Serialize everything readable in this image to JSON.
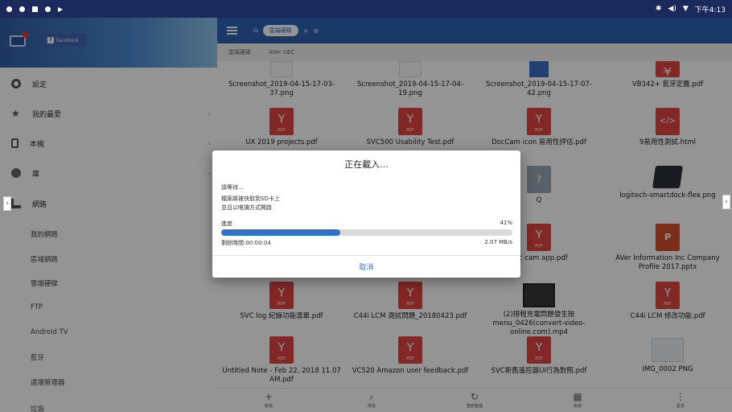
{
  "status_bar": {
    "time": "下午4:13"
  },
  "drawer": {
    "account_label": "Facebook",
    "items": [
      {
        "label": "設定"
      },
      {
        "label": "我的最愛"
      },
      {
        "label": "本機"
      },
      {
        "label": "庫"
      },
      {
        "label": "網路"
      }
    ],
    "network_subitems": [
      "我的網路",
      "區域網路",
      "雲端硬碟",
      "FTP",
      "Android TV",
      "藍牙",
      "遠端管理器",
      "垃圾"
    ]
  },
  "topbar": {
    "tab_label": "雲端硬碟"
  },
  "pathbar": {
    "segments": [
      "雲端硬碟",
      "AVer UEC"
    ]
  },
  "files": [
    {
      "name": "Screenshot_2019-04-15-17-03-37.png",
      "kind": "image"
    },
    {
      "name": "Screenshot_2019-04-15-17-04-19.png",
      "kind": "image"
    },
    {
      "name": "Screenshot_2019-04-15-17-07-42.png",
      "kind": "image"
    },
    {
      "name": "VB342+ 藍牙定義.pdf",
      "kind": "pdf"
    },
    {
      "name": "UX 2019 projects.pdf",
      "kind": "pdf"
    },
    {
      "name": "SVC500 Usability Test.pdf",
      "kind": "pdf"
    },
    {
      "name": "DocCam icon 易用性評估.pdf",
      "kind": "pdf"
    },
    {
      "name": "9易用性測試.html",
      "kind": "html"
    },
    {
      "name": "Q",
      "kind": "unknown"
    },
    {
      "name": "logitech-smartdock-flex.png",
      "kind": "image"
    },
    {
      "name": "doc cam app.pdf",
      "kind": "pdf"
    },
    {
      "name": "AVer Information Inc Company Profile 2017.pptx",
      "kind": "pptx"
    },
    {
      "name": "SVC log 紀錄功能清單.pdf",
      "kind": "pdf"
    },
    {
      "name": "C44i LCM 測試問題_20180423.pdf",
      "kind": "pdf"
    },
    {
      "name": "(2)排程充電問題發生按menu_0426(convert-video-online.com).mp4",
      "kind": "video"
    },
    {
      "name": "C44i LCM 修改功能.pdf",
      "kind": "pdf"
    },
    {
      "name": "Untitled Note - Feb 22, 2018 11.07 AM.pdf",
      "kind": "pdf"
    },
    {
      "name": "VC520 Amazon user feedback.pdf",
      "kind": "pdf"
    },
    {
      "name": "SVC新舊遙控器UI行為對照.pdf",
      "kind": "pdf"
    },
    {
      "name": "IMG_0002.PNG",
      "kind": "image"
    }
  ],
  "bottom_bar": [
    {
      "label": "新增",
      "icon": "plus-icon"
    },
    {
      "label": "搜尋",
      "icon": "search-icon"
    },
    {
      "label": "重新整理",
      "icon": "refresh-icon"
    },
    {
      "label": "檢視",
      "icon": "grid-icon"
    },
    {
      "label": "更多",
      "icon": "more-icon"
    }
  ],
  "dialog": {
    "title": "正在載入...",
    "wait_text": "請等待...",
    "line1": "檔案將被快取到SD卡上",
    "line2": "並且以唯讀方式開啟",
    "progress_label": "進度",
    "progress_percent": "41%",
    "progress_value": 0.41,
    "remaining_time": "剩餘時間:00:00:04",
    "speed": "2.07 MB/s",
    "cancel_label": "取消"
  }
}
